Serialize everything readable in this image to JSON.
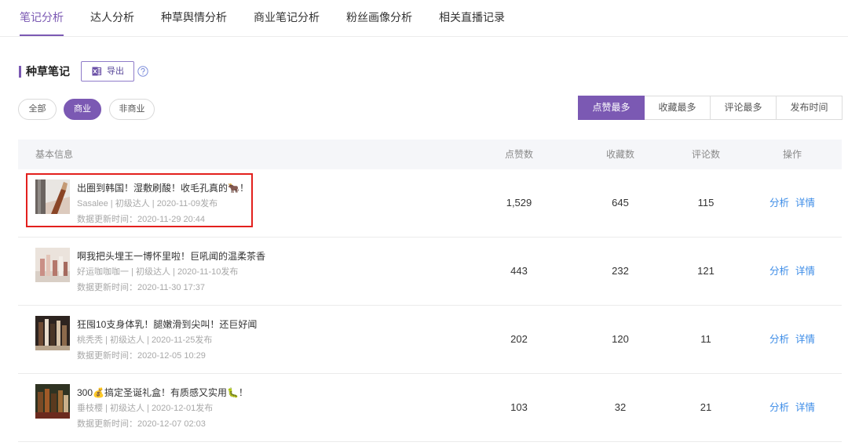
{
  "colors": {
    "accent": "#7b59b3",
    "link": "#3c8ce7",
    "highlight": "#e3201d",
    "table_header_bg": "#f5f6f9"
  },
  "nav": {
    "tabs": [
      {
        "label": "笔记分析",
        "active": true
      },
      {
        "label": "达人分析"
      },
      {
        "label": "种草舆情分析"
      },
      {
        "label": "商业笔记分析"
      },
      {
        "label": "粉丝画像分析"
      },
      {
        "label": "相关直播记录"
      }
    ]
  },
  "section": {
    "title": "种草笔记",
    "export_label": "导出",
    "export_icon": "excel-icon",
    "help_icon": "question-circle-icon"
  },
  "filters": [
    {
      "label": "全部"
    },
    {
      "label": "商业",
      "active": true
    },
    {
      "label": "非商业"
    }
  ],
  "sort": [
    {
      "label": "点赞最多",
      "active": true
    },
    {
      "label": "收藏最多"
    },
    {
      "label": "评论最多"
    },
    {
      "label": "发布时间"
    }
  ],
  "table": {
    "columns": {
      "info": "基本信息",
      "likes": "点赞数",
      "collects": "收藏数",
      "comments": "评论数",
      "actions": "操作"
    },
    "action_labels": {
      "analyze": "分析",
      "detail": "详情"
    },
    "rows": [
      {
        "title": "出圈到韩国！湿敷刷酸！收毛孔真的🐂！",
        "meta": "Sasalee | 初级达人 | 2020-11-09发布",
        "updated": "数据更新时间：2020-11-29 20:44",
        "likes": "1,529",
        "collects": "645",
        "comments": "115",
        "highlighted": true
      },
      {
        "title": "啊我把头埋王一博怀里啦！巨吼闻的温柔茶香",
        "meta": "好运咖咖咖一 | 初级达人 | 2020-11-10发布",
        "updated": "数据更新时间：2020-11-30 17:37",
        "likes": "443",
        "collects": "232",
        "comments": "121"
      },
      {
        "title": "狂囤10支身体乳！腿嫩滑到尖叫！还巨好闻",
        "meta": "桃秃秃 | 初级达人 | 2020-11-25发布",
        "updated": "数据更新时间：2020-12-05 10:29",
        "likes": "202",
        "collects": "120",
        "comments": "11"
      },
      {
        "title": "300💰搞定圣诞礼盒！有质感又实用🐛！",
        "meta": "垂枝樱 | 初级达人 | 2020-12-01发布",
        "updated": "数据更新时间：2020-12-07 02:03",
        "likes": "103",
        "collects": "32",
        "comments": "21"
      }
    ]
  }
}
